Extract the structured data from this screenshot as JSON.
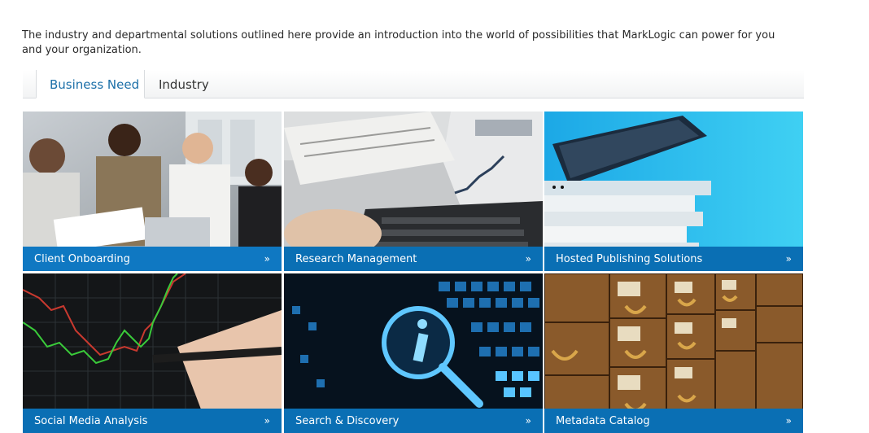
{
  "intro_text": "The industry and departmental solutions outlined here provide an introduction into the world of possibilities that MarkLogic can power for you and your organization.",
  "tabs": [
    {
      "label": "Business Need",
      "active": true
    },
    {
      "label": "Industry",
      "active": false
    }
  ],
  "tiles": [
    {
      "label": "Client Onboarding",
      "arrow": "»",
      "image": "business-meeting-photo"
    },
    {
      "label": "Research Management",
      "arrow": "»",
      "image": "newspaper-laptop-photo"
    },
    {
      "label": "Hosted Publishing Solutions",
      "arrow": "»",
      "image": "laptop-books-photo"
    },
    {
      "label": "Social Media Analysis",
      "arrow": "»",
      "image": "stock-chart-pen-photo"
    },
    {
      "label": "Search & Discovery",
      "arrow": "»",
      "image": "info-magnifier-photo"
    },
    {
      "label": "Metadata Catalog",
      "arrow": "»",
      "image": "card-catalog-photo"
    }
  ],
  "colors": {
    "caption_bg": "#0a6fb4",
    "tab_active_text": "#1b6fa8"
  }
}
